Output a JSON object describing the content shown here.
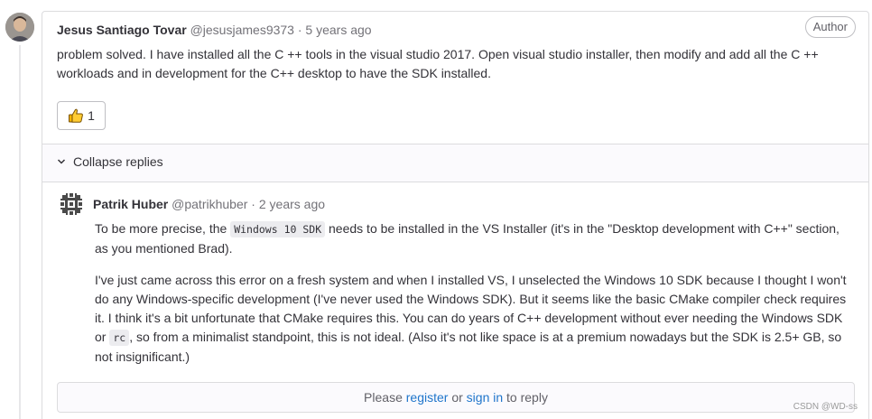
{
  "note": {
    "author_name": "Jesus Santiago Tovar",
    "username": "@jesusjames9373",
    "separator": "·",
    "time": "5 years ago",
    "badge": "Author",
    "body": "problem solved. I have installed all the C ++ tools in the visual studio 2017. Open visual studio installer, then modify and add all the C ++ workloads and in development for the C++ desktop to have the SDK installed.",
    "reaction": {
      "icon": "thumbs-up-icon",
      "count": "1"
    }
  },
  "replies": {
    "collapse_label": "Collapse replies",
    "reply": {
      "author_name": "Patrik Huber",
      "username": "@patrikhuber",
      "separator": "·",
      "time": "2 years ago",
      "p1": {
        "before": "To be more precise, the ",
        "code": "Windows 10 SDK",
        "after": " needs to be installed in the VS Installer (it's in the \"Desktop development with C++\" section, as you mentioned Brad)."
      },
      "p2": {
        "before": "I've just came across this error on a fresh system and when I installed VS, I unselected the Windows 10 SDK because I thought I won't do any Windows-specific development (I've never used the Windows SDK). But it seems like the basic CMake compiler check requires it. I think it's a bit unfortunate that CMake requires this. You can do years of C++ development without ever needing the Windows SDK or ",
        "code": "rc",
        "after": ", so from a minimalist standpoint, this is not ideal. (Also it's not like space is at a premium nowadays but the SDK is 2.5+ GB, so not insignificant.)"
      }
    },
    "reply_box": {
      "please": "Please",
      "register": "register",
      "or": "or",
      "sign_in": "sign in",
      "to_reply": "to reply"
    }
  },
  "watermark": "CSDN @WD-ss",
  "colors": {
    "link": "#1f75cb",
    "border": "#dcdcde",
    "text": "#333238",
    "muted": "#737278"
  }
}
